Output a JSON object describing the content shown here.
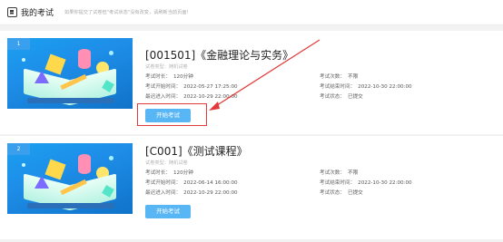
{
  "header": {
    "title": "我的考试",
    "notice": "如果你提交了试卷但\"考试状态\"没有改变，请刷新当前页面!"
  },
  "exams": [
    {
      "index": "1",
      "title": "[001501]《金融理论与实务》",
      "type_label": "试卷类型：",
      "type_value": "随机试卷",
      "duration_label": "考试时长：",
      "duration_value": "120分钟",
      "start_label": "考试开始时间：",
      "start_value": "2022-05-27 17:25:00",
      "last_label": "最迟进入时间：",
      "last_value": "2022-10-29 22:00:00",
      "count_label": "考试次数：",
      "count_value": "不限",
      "end_label": "考试结束时间：",
      "end_value": "2022-10-30 22:00:00",
      "status_label": "考试状态：",
      "status_value": "已提交",
      "button": "开始考试"
    },
    {
      "index": "2",
      "title": "[C001]《测试课程》",
      "type_label": "试卷类型：",
      "type_value": "随机试卷",
      "duration_label": "考试时长：",
      "duration_value": "120分钟",
      "start_label": "考试开始时间：",
      "start_value": "2022-06-14 16:00:00",
      "last_label": "最迟进入时间：",
      "last_value": "2022-10-29 22:00:00",
      "count_label": "考试次数：",
      "count_value": "不限",
      "end_label": "考试结束时间：",
      "end_value": "2022-10-30 22:00:00",
      "status_label": "考试状态：",
      "status_value": "已提交",
      "button": "开始考试"
    }
  ],
  "colors": {
    "accent": "#58b6f5",
    "annotation": "#e23a3a",
    "badge": "#3aa0ee"
  }
}
